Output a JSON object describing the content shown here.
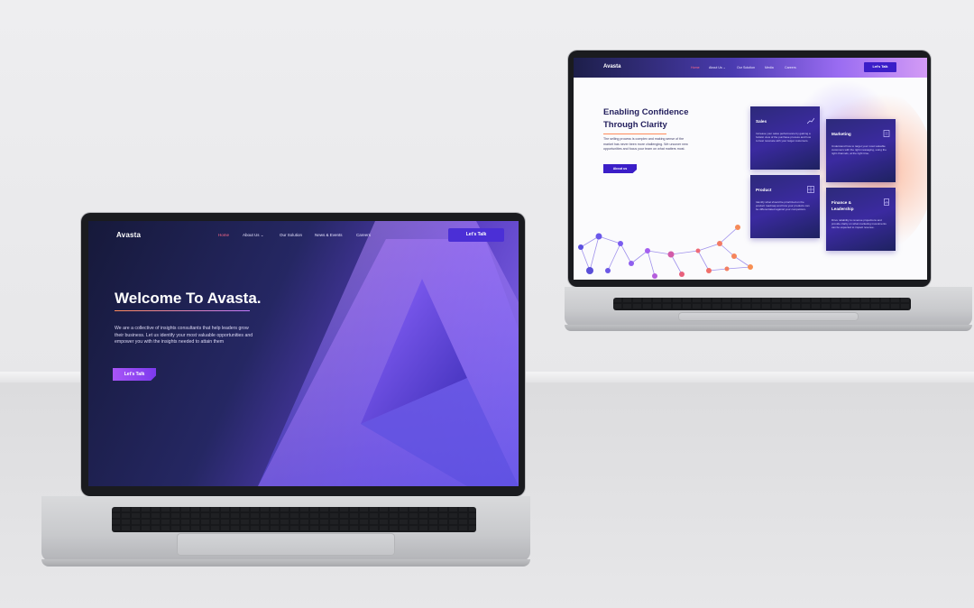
{
  "left_site": {
    "logo": "Avasta",
    "nav": [
      "Home",
      "About Us",
      "Our Solution",
      "News & Events",
      "Careers"
    ],
    "active_nav": "Home",
    "nav_dropdown_icon": "chevron-down-icon",
    "cta": "Let's Talk",
    "hero_title": "Welcome To Avasta.",
    "hero_text": "We are a collective of insights consultants that help leaders grow their business. Let us identify your most valuable opportunities and empower you with the insights needed to attain them",
    "hero_button": "Let's Talk",
    "colors": {
      "accent": "#4b2fd6",
      "button": "#a855f7",
      "active_nav": "#ff6b8a"
    }
  },
  "right_site": {
    "logo": "Avasta",
    "nav": [
      "Home",
      "About Us",
      "Our Solution",
      "Media",
      "Careers"
    ],
    "active_nav": "Home",
    "cta": "Let's Talk",
    "heading_line1": "Enabling Confidence",
    "heading_line2": "Through Clarity",
    "body": "The selling process is complex and making sense of the market has never been more challenging. We uncover new opportunities and focus your team on what matters most.",
    "button": "About us",
    "cards": [
      {
        "title": "Sales",
        "icon": "chart-icon",
        "text": "Increase your sales performance by gaining a holistic view of the purchase process and how to best resonate with your target customers."
      },
      {
        "title": "Marketing",
        "icon": "document-icon",
        "text": "Understand how to target your most valuable customers with the right messaging, using the right channels, at the right time."
      },
      {
        "title": "Product",
        "icon": "grid-icon",
        "text": "Identify what should be prioritized on the product roadmap and how your products can be differentiated against your competitors."
      },
      {
        "title": "Finance &",
        "title2": "Leadership",
        "icon": "report-icon",
        "text": "Drive reliability to revenue projections and provide clarity on what marketing investments can be expected to impact revenue."
      }
    ]
  }
}
